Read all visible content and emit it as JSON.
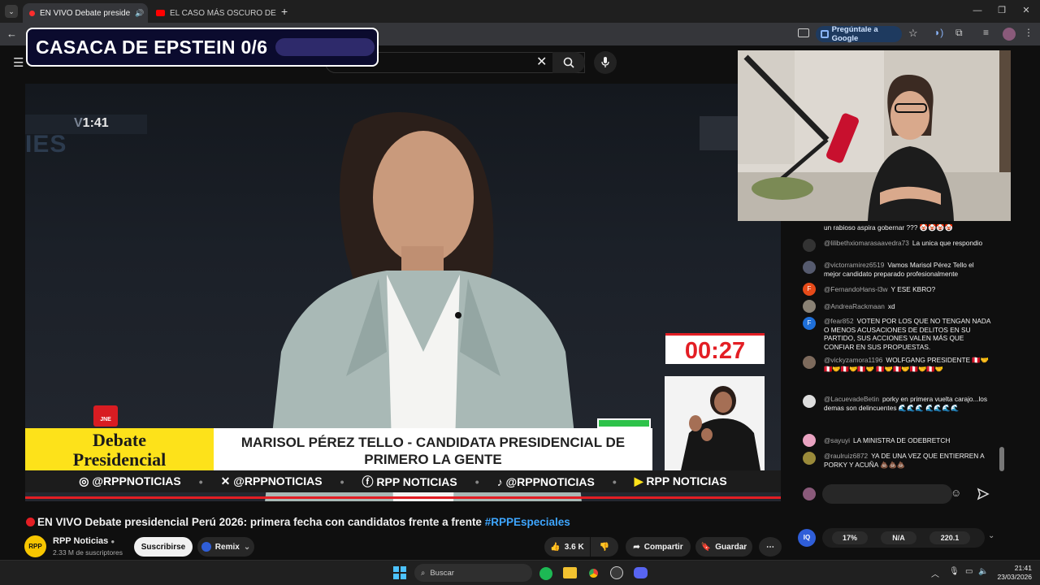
{
  "browser": {
    "tabs": [
      {
        "label": "EN VIVO Debate preside",
        "active": true
      },
      {
        "label": "EL CASO MÁS OSCURO DE TWI",
        "active": false
      }
    ],
    "ask_google": "Pregúntale a Google"
  },
  "overlay": {
    "title": "CASACA DE EPSTEIN 0/6"
  },
  "video": {
    "clock": "1:41",
    "clock_prefix": "V",
    "bg_text": "IES",
    "lower_third_left": "Debate Presidencial",
    "lower_third_left_l1": "Debate",
    "lower_third_left_l2": "Presidencial",
    "candidate_l1": "MARISOL PÉREZ TELLO - CANDIDATA PRESIDENCIAL DE",
    "candidate_l2": "PRIMERO LA GENTE",
    "timer": "00:27",
    "jne": "JNE",
    "socials": [
      "@RPPNOTICIAS",
      "@RPPNOTICIAS",
      "RPP NOTICIAS",
      "@RPPNOTICIAS",
      "RPP NOTICIAS"
    ]
  },
  "chat": {
    "messages": [
      {
        "user": "",
        "text": "un rabioso aspira gobernar ??? 🤡🤡🤡🤡"
      },
      {
        "user": "@lilibethxiomarasaavedra73",
        "text": "La unica que respondio"
      },
      {
        "user": "@victorramirez6519",
        "text": "Vamos Marisol Pérez Tello el mejor candidato preparado profesionalmente"
      },
      {
        "user": "@FernandoHans-l3w",
        "text": "Y ESE KBRO?"
      },
      {
        "user": "@AndreaRackmaan",
        "text": "xd"
      },
      {
        "user": "@fear852",
        "text": "VOTEN POR LOS QUE NO TENGAN NADA O MENOS ACUSACIONES DE DELITOS EN SU PARTIDO, SUS ACCIONES VALEN MÁS QUE CONFIAR EN SUS PROPUESTAS."
      },
      {
        "user": "@vickyzamora1196",
        "text": "WOLFGANG PRESIDENTE 🇵🇪🤝🇵🇪🤝🇵🇪🤝🇵🇪🤝 🇵🇪🤝🇵🇪🤝🇵🇪🤝🇵🇪🤝"
      },
      {
        "user": "@LacuevadeBetin",
        "text": "porky en primera vuelta carajo...los demas son delincuentes 🌊🌊🌊 🌊🌊🌊🌊"
      },
      {
        "user": "@sayuyi",
        "text": "LA MINISTRA DE ODEBRETCH"
      },
      {
        "user": "@raulruiz6872",
        "text": "YA DE UNA VEZ QUE ENTIERREN A PORKY Y ACUÑA 💩💩💩"
      }
    ],
    "avatar_letters": [
      "F",
      "F"
    ]
  },
  "stats": {
    "s1": "17%",
    "s2": "N/A",
    "s3": "220.1",
    "badge": "IQ"
  },
  "page": {
    "title_main": "EN VIVO Debate presidencial Perú 2026: primera fecha con candidatos frente a frente ",
    "title_tag": "#RPPEspeciales",
    "channel": "RPP Noticias",
    "subs": "2.33 M de suscriptores",
    "subscribe": "Suscribirse",
    "remix": "Remix",
    "likes": "3.6 K",
    "share": "Compartir",
    "save": "Guardar",
    "logo": "RPP"
  },
  "taskbar": {
    "search": "Buscar",
    "time": "21:41",
    "date": "23/03/2026"
  },
  "colors": {
    "accent_red": "#e31e24",
    "debate_yellow": "#fde21a",
    "link_blue": "#3ea6ff"
  }
}
